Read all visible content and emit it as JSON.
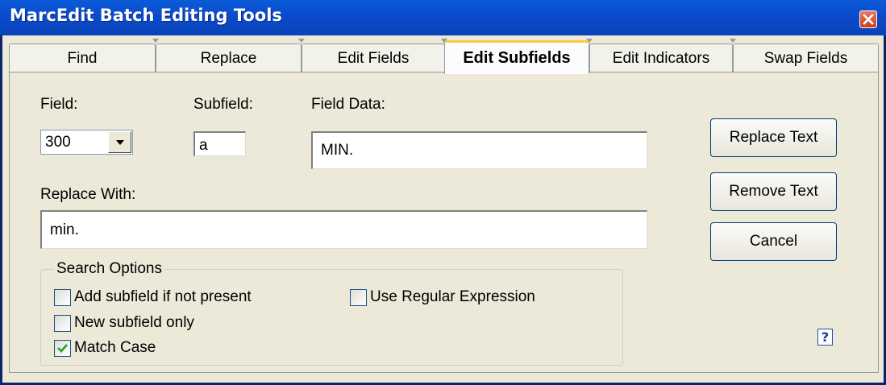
{
  "window": {
    "title": "MarcEdit Batch Editing Tools"
  },
  "tabs": [
    {
      "label": "Find",
      "active": false
    },
    {
      "label": "Replace",
      "active": false
    },
    {
      "label": "Edit Fields",
      "active": false
    },
    {
      "label": "Edit Subfields",
      "active": true
    },
    {
      "label": "Edit Indicators",
      "active": false
    },
    {
      "label": "Swap Fields",
      "active": false
    }
  ],
  "form": {
    "field_label": "Field:",
    "field_value": "300",
    "subfield_label": "Subfield:",
    "subfield_value": "a",
    "field_data_label": "Field Data:",
    "field_data_value": "MIN.",
    "replace_with_label": "Replace With:",
    "replace_with_value": "min."
  },
  "buttons": {
    "replace_text": "Replace Text",
    "remove_text": "Remove Text",
    "cancel": "Cancel"
  },
  "search_options": {
    "title": "Search Options",
    "add_subfield": {
      "label": "Add subfield if not present",
      "checked": false
    },
    "new_subfield_only": {
      "label": "New subfield only",
      "checked": false
    },
    "match_case": {
      "label": "Match Case",
      "checked": true
    },
    "use_regex": {
      "label": "Use Regular Expression",
      "checked": false
    }
  },
  "icons": {
    "close": "close-icon",
    "dropdown": "chevron-down-icon",
    "help": "help-icon",
    "check": "checkmark-icon"
  },
  "colors": {
    "titlebar": "#0b4ccf",
    "window_bg": "#ece9d8",
    "active_tab_accent": "#ffc83c",
    "check_green": "#21a121"
  }
}
